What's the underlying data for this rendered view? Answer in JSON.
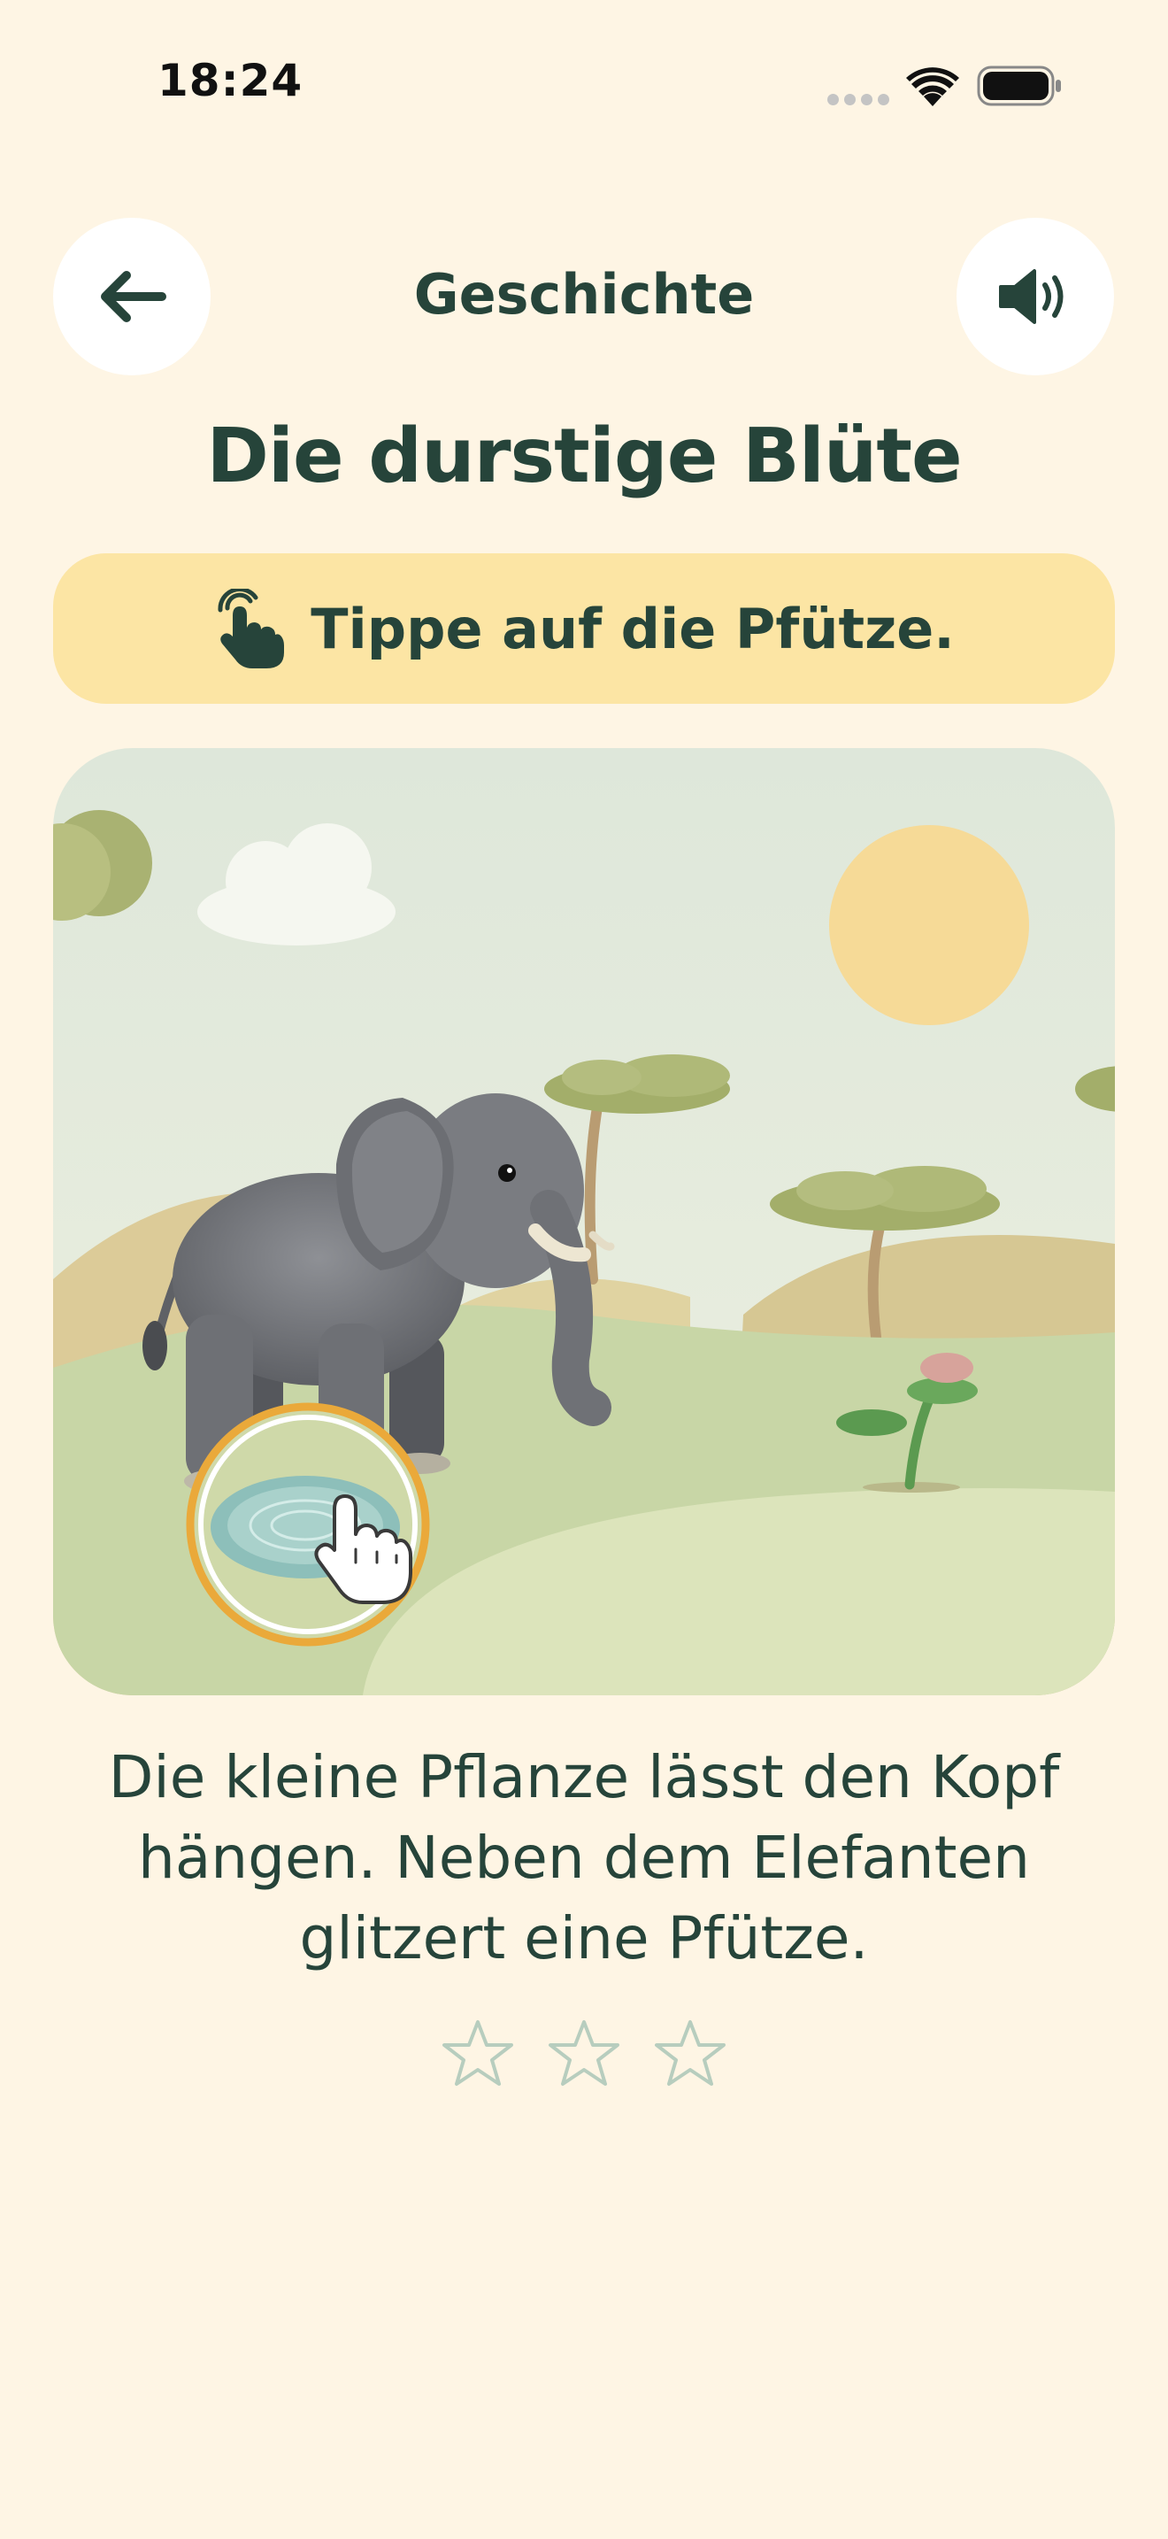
{
  "status_bar": {
    "time": "18:24"
  },
  "header": {
    "title": "Geschichte",
    "back_icon": "arrow-left-icon",
    "sound_icon": "speaker-icon"
  },
  "story": {
    "title": "Die durstige Blüte",
    "instruction": "Tippe auf die Pfütze.",
    "instruction_icon": "tap-hand-icon",
    "text": "Die kleine Pflanze lässt den Kopf hängen. Neben dem Elefanten glitzert eine Pfütze.",
    "stars_total": 3,
    "stars_earned": 0
  },
  "colors": {
    "background": "#FEF5E4",
    "text": "#26443A",
    "instruction_bg": "#FCE5A4",
    "highlight_ring": "#EAA93A",
    "star_outline": "#B7CDBE"
  }
}
